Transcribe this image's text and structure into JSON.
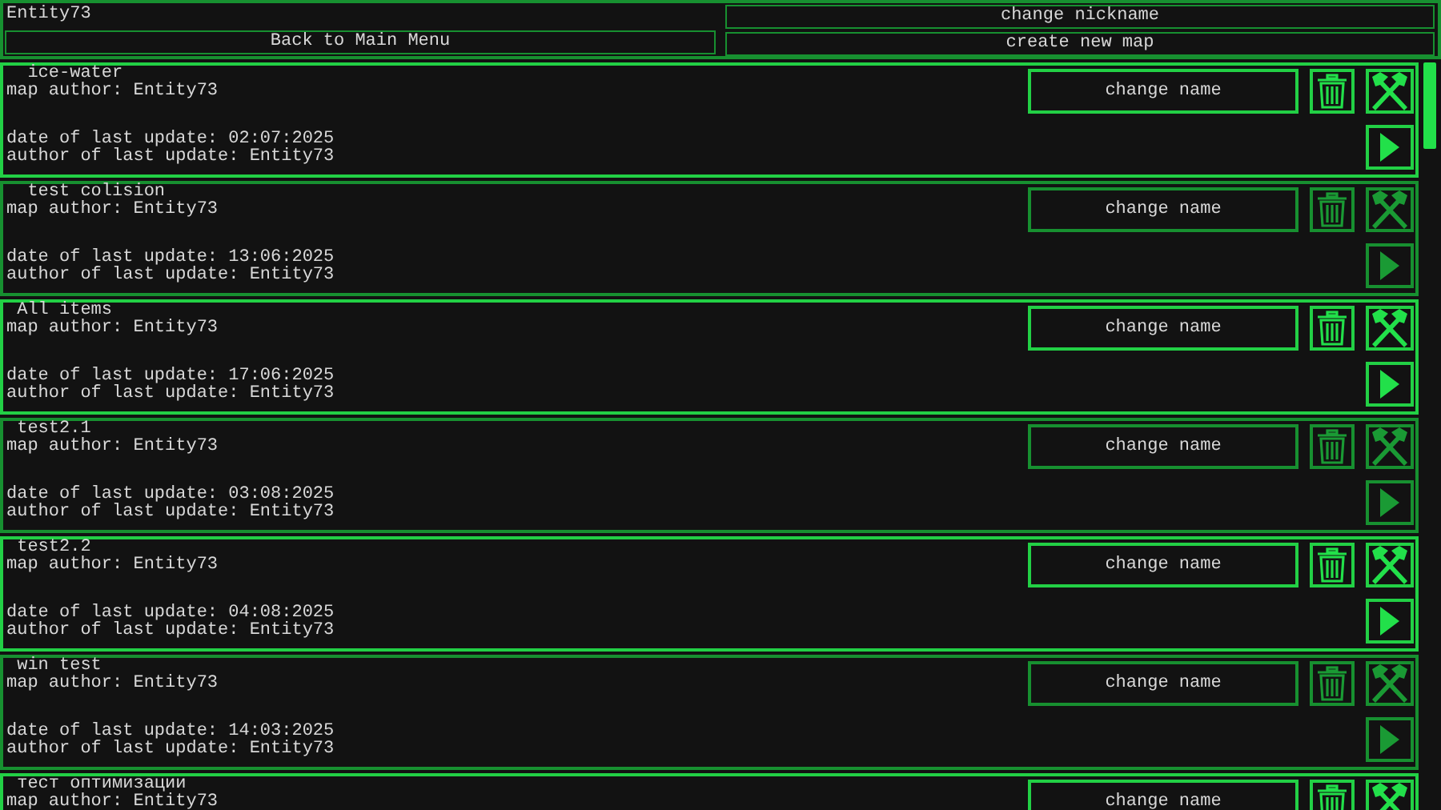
{
  "header": {
    "nickname": "Entity73",
    "change_nickname": "change nickname",
    "back": "Back to Main Menu",
    "create_map": "create new map"
  },
  "maps": [
    {
      "name": "  ice-water",
      "author": "map author: Entity73",
      "date": "date of last update: 02:07:2025",
      "updater": "author of last update: Entity73",
      "rename": "change name",
      "highlighted": true
    },
    {
      "name": "  test colision",
      "author": "map author: Entity73",
      "date": "date of last update: 13:06:2025",
      "updater": "author of last update: Entity73",
      "rename": "change name",
      "highlighted": false
    },
    {
      "name": " All items",
      "author": "map author: Entity73",
      "date": "date of last update: 17:06:2025",
      "updater": "author of last update: Entity73",
      "rename": "change name",
      "highlighted": true
    },
    {
      "name": " test2.1",
      "author": "map author: Entity73",
      "date": "date of last update: 03:08:2025",
      "updater": "author of last update: Entity73",
      "rename": "change name",
      "highlighted": false
    },
    {
      "name": " test2.2",
      "author": "map author: Entity73",
      "date": "date of last update: 04:08:2025",
      "updater": "author of last update: Entity73",
      "rename": "change name",
      "highlighted": true
    },
    {
      "name": " win test",
      "author": "map author: Entity73",
      "date": "date of last update: 14:03:2025",
      "updater": "author of last update: Entity73",
      "rename": "change name",
      "highlighted": false
    },
    {
      "name": " тест оптимизации",
      "author": "map author: Entity73",
      "rename": "change name",
      "highlighted": true
    }
  ]
}
